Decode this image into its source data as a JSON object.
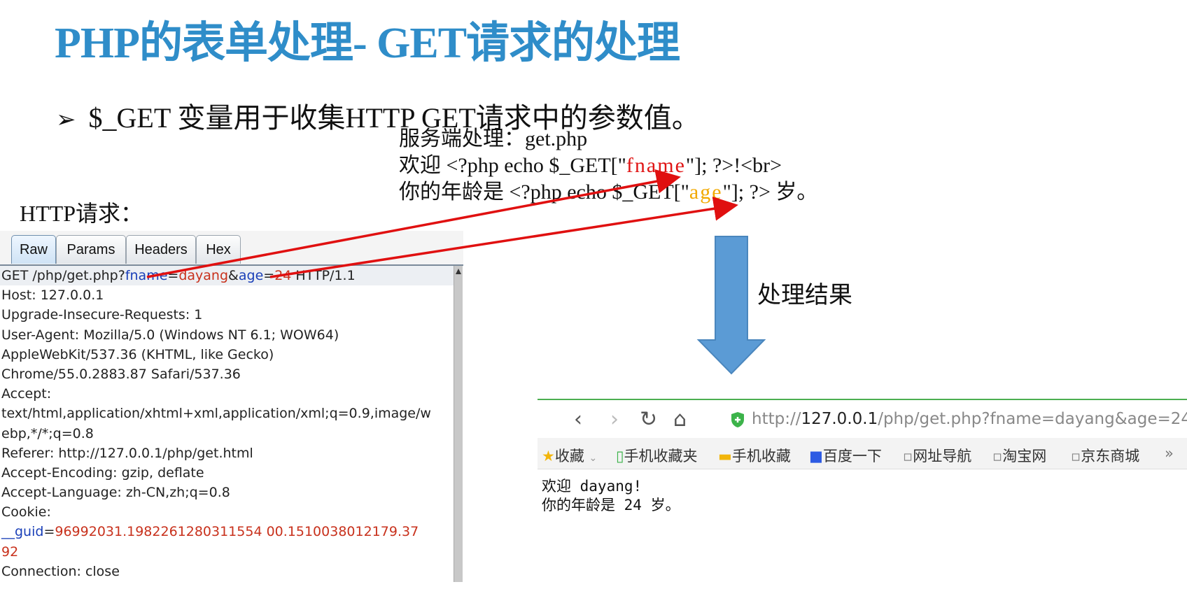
{
  "slide": {
    "title": "PHP的表单处理- GET请求的处理",
    "bullet_marker": "➢",
    "bullet_text": "$_GET 变量用于收集HTTP GET请求中的参数值。"
  },
  "server_code": {
    "line1": "服务端处理：get.php",
    "line2_prefix": "欢迎 <?php echo $_GET[\"",
    "line2_key": "fname",
    "line2_suffix": "\"]; ?>!<br>",
    "line3_prefix": "你的年龄是 <?php echo $_GET[\"",
    "line3_key": "age",
    "line3_suffix": "\"]; ?>  岁。"
  },
  "http_label": "HTTP请求：",
  "request_panel": {
    "tabs": [
      "Raw",
      "Params",
      "Headers",
      "Hex"
    ],
    "active_tab": "Raw",
    "request_line": {
      "prefix": "GET /php/get.php?",
      "p1_key": "fname",
      "eq1": "=",
      "p1_val": "dayang",
      "amp": "&",
      "p2_key": "age",
      "eq2": "=",
      "p2_val": "24",
      "suffix": " HTTP/1.1"
    },
    "lines": [
      "Host: 127.0.0.1",
      "Upgrade-Insecure-Requests: 1",
      "User-Agent: Mozilla/5.0 (Windows NT 6.1; WOW64)",
      "AppleWebKit/537.36 (KHTML, like Gecko)",
      "Chrome/55.0.2883.87 Safari/537.36",
      "Accept:",
      "text/html,application/xhtml+xml,application/xml;q=0.9,image/w",
      "ebp,*/*;q=0.8",
      "Referer: http://127.0.0.1/php/get.html",
      "Accept-Encoding: gzip, deflate",
      "Accept-Language: zh-CN,zh;q=0.8",
      "Cookie:"
    ],
    "cookie_key": "__guid",
    "cookie_eq": "=",
    "cookie_val_1": "96992031.1982261280311554 00.1510038012179.37",
    "cookie_val_2": "92",
    "last_line": "Connection: close"
  },
  "process_label": "处理结果",
  "browser": {
    "back_icon": "‹",
    "forward_icon": "›",
    "reload_icon": "↻",
    "home_icon": "⌂",
    "url_scheme": "http://",
    "url_host": "127.0.0.1",
    "url_path": "/php/get.php?fname=dayang&age=24",
    "bookmarks": [
      "收藏",
      "手机收藏夹",
      "手机收藏",
      "百度一下",
      "网址导航",
      "淘宝网",
      "京东商城"
    ],
    "bookmarks_more": "»",
    "page_line1": "欢迎 dayang!",
    "page_line2": "你的年龄是 24 岁。"
  },
  "colors": {
    "title": "#2f8dc9",
    "fname_highlight": "#e01515",
    "age_highlight": "#f2a900",
    "arrow_blue": "#5b9bd5",
    "arrow_red": "#e01010"
  }
}
